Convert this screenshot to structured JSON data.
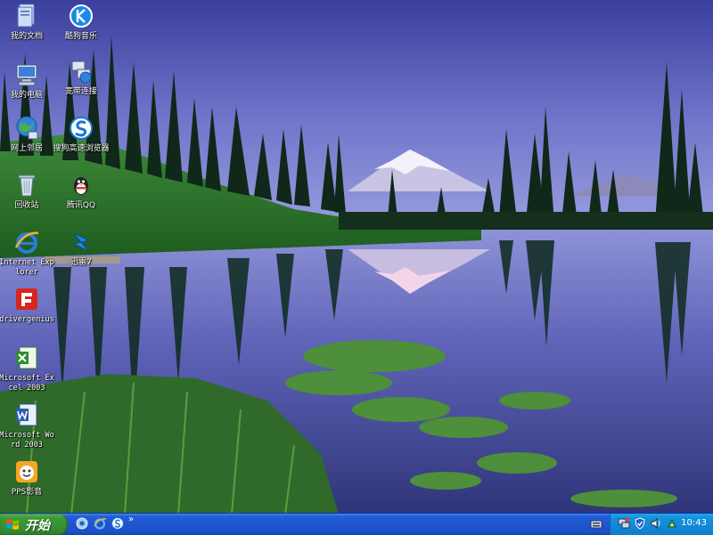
{
  "desktop": {
    "icons": [
      {
        "label": "我的文档",
        "icon": "my-documents-icon"
      },
      {
        "label": "酷狗音乐",
        "icon": "kugou-music-icon"
      },
      {
        "label": "我的电脑",
        "icon": "my-computer-icon"
      },
      {
        "label": "宽带连接",
        "icon": "broadband-connection-icon"
      },
      {
        "label": "网上邻居",
        "icon": "network-places-icon"
      },
      {
        "label": "搜狗高速浏览器",
        "icon": "sogou-browser-icon"
      },
      {
        "label": "回收站",
        "icon": "recycle-bin-icon"
      },
      {
        "label": "腾讯QQ",
        "icon": "qq-penguin-icon"
      },
      {
        "label": "Internet Explorer",
        "icon": "internet-explorer-icon"
      },
      {
        "label": "迅雷7",
        "icon": "thunder-icon"
      },
      {
        "label": "drivergenius",
        "icon": "drivergenius-icon"
      },
      {
        "label": "Microsoft Excel 2003",
        "icon": "excel-icon"
      },
      {
        "label": "Microsoft Word 2003",
        "icon": "word-icon"
      },
      {
        "label": "PPS影音",
        "icon": "pps-player-icon"
      }
    ]
  },
  "taskbar": {
    "start_label": "开始",
    "quick_launch": [
      "show-desktop-icon",
      "ie-quicklaunch-icon",
      "sogou-quicklaunch-icon"
    ],
    "quick_launch_more": "»",
    "tray_icons": [
      "network-tray-icon",
      "security-shield-icon",
      "volume-icon",
      "sound-icon"
    ],
    "clock": "10:43"
  },
  "colors": {
    "taskbar_blue": "#245edb",
    "start_green": "#379233",
    "tray_blue": "#1288d4",
    "sky_top": "#3b46a6",
    "sky_bottom": "#8a8fd8"
  }
}
